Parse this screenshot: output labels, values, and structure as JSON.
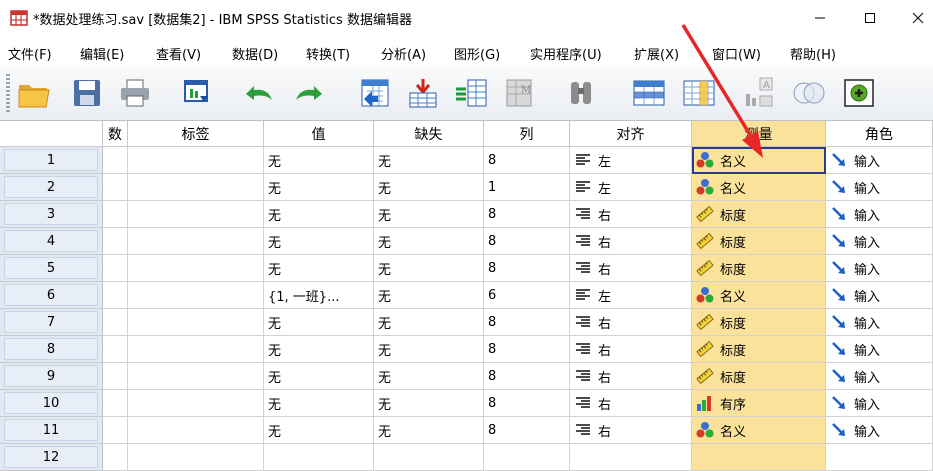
{
  "window": {
    "title": "*数据处理练习.sav [数据集2] - IBM SPSS Statistics 数据编辑器",
    "min_glyph": "—",
    "max_glyph": "☐",
    "close_glyph": "✕"
  },
  "menu": [
    "文件(F)",
    "编辑(E)",
    "查看(V)",
    "数据(D)",
    "转换(T)",
    "分析(A)",
    "图形(G)",
    "实用程序(U)",
    "扩展(X)",
    "窗口(W)",
    "帮助(H)"
  ],
  "toolbar": [
    "open-icon",
    "save-icon",
    "print-icon",
    "dialog-recall-icon",
    "undo-icon",
    "redo-icon",
    "goto-case-icon",
    "goto-variable-icon",
    "variables-icon",
    "run-descriptive-icon",
    "find-icon",
    "insert-cases-icon",
    "insert-variable-icon",
    "split-file-icon",
    "weight-cases-icon",
    "select-cases-icon",
    "value-labels-icon",
    "use-variable-sets-icon"
  ],
  "columns": [
    "数",
    "标签",
    "值",
    "缺失",
    "列",
    "对齐",
    "测量",
    "角色"
  ],
  "selected_column": "测量",
  "rows": [
    {
      "num": "1",
      "label": "",
      "values": "无",
      "missing": "无",
      "cols": "8",
      "align": "左",
      "measure": "名义",
      "measure_icon": "nominal-icon",
      "role": "输入"
    },
    {
      "num": "2",
      "label": "",
      "values": "无",
      "missing": "无",
      "cols": "1",
      "align": "左",
      "measure": "名义",
      "measure_icon": "nominal-icon",
      "role": "输入"
    },
    {
      "num": "3",
      "label": "",
      "values": "无",
      "missing": "无",
      "cols": "8",
      "align": "右",
      "measure": "标度",
      "measure_icon": "scale-icon",
      "role": "输入"
    },
    {
      "num": "4",
      "label": "",
      "values": "无",
      "missing": "无",
      "cols": "8",
      "align": "右",
      "measure": "标度",
      "measure_icon": "scale-icon",
      "role": "输入"
    },
    {
      "num": "5",
      "label": "",
      "values": "无",
      "missing": "无",
      "cols": "8",
      "align": "右",
      "measure": "标度",
      "measure_icon": "scale-icon",
      "role": "输入"
    },
    {
      "num": "6",
      "label": "",
      "values": "{1, 一班}...",
      "missing": "无",
      "cols": "6",
      "align": "左",
      "measure": "名义",
      "measure_icon": "nominal-icon",
      "role": "输入"
    },
    {
      "num": "7",
      "label": "",
      "values": "无",
      "missing": "无",
      "cols": "8",
      "align": "右",
      "measure": "标度",
      "measure_icon": "scale-icon",
      "role": "输入"
    },
    {
      "num": "8",
      "label": "",
      "values": "无",
      "missing": "无",
      "cols": "8",
      "align": "右",
      "measure": "标度",
      "measure_icon": "scale-icon",
      "role": "输入"
    },
    {
      "num": "9",
      "label": "",
      "values": "无",
      "missing": "无",
      "cols": "8",
      "align": "右",
      "measure": "标度",
      "measure_icon": "scale-icon",
      "role": "输入"
    },
    {
      "num": "10",
      "label": "",
      "values": "无",
      "missing": "无",
      "cols": "8",
      "align": "右",
      "measure": "有序",
      "measure_icon": "ordinal-icon",
      "role": "输入"
    },
    {
      "num": "11",
      "label": "",
      "values": "无",
      "missing": "无",
      "cols": "8",
      "align": "右",
      "measure": "名义",
      "measure_icon": "nominal-icon",
      "role": "输入"
    },
    {
      "num": "12",
      "label": "",
      "values": "",
      "missing": "",
      "cols": "",
      "align": "",
      "measure": "",
      "measure_icon": "",
      "role": ""
    }
  ],
  "active_cell": {
    "row": "1",
    "column": "测量"
  },
  "annotation": {
    "type": "red-arrow",
    "points_to": "测量"
  },
  "colors": {
    "selected_column": "#fbe29a",
    "row_header": "#e1e9f5",
    "active_border": "#2a3a8c",
    "arrow": "#e8262a"
  }
}
